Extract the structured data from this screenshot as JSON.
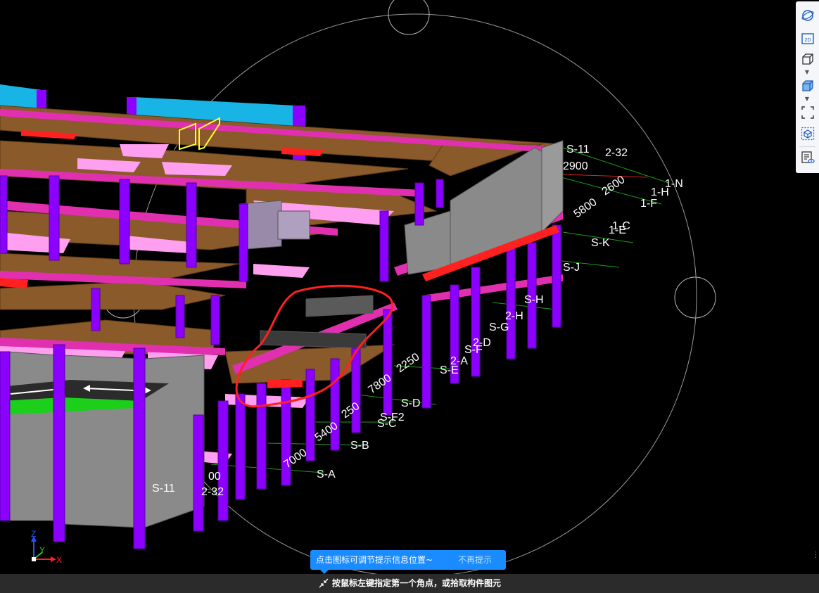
{
  "tip": {
    "text": "点击图标可调节提示信息位置~",
    "dismiss": "不再提示"
  },
  "status": {
    "text": "按鼠标左键指定第一个角点，或拾取构件图元"
  },
  "toolbar": {
    "items": [
      {
        "icon": "orbit-icon"
      },
      {
        "icon": "2d-view-icon",
        "text": "2D"
      },
      {
        "icon": "3d-box-icon"
      },
      {
        "icon": "dropdown-caret-icon"
      },
      {
        "icon": "3d-solid-box-icon"
      },
      {
        "icon": "dropdown-caret-icon"
      },
      {
        "icon": "zoom-extents-icon"
      },
      {
        "icon": "component-selection-icon"
      },
      {
        "icon": "properties-view-icon"
      }
    ]
  },
  "axis_triad": {
    "z": "Z",
    "y": "Y",
    "x": "X"
  },
  "grid_labels": [
    "S-11",
    "2-32",
    "2900",
    "1-H",
    "1-N",
    "1-F",
    "1-C",
    "1-E",
    "S-K",
    "S-J",
    "2-H",
    "S-H",
    "S-G",
    "2-D",
    "S-F",
    "2-A",
    "S-E",
    "2250",
    "7800",
    "S-D",
    "250",
    "5400",
    "S-C",
    "S-B",
    "7000",
    "S-A",
    "00",
    "S-11",
    "2-32",
    "S-F2",
    "5800",
    "2600"
  ],
  "colors": {
    "background": "#000000",
    "column": "#8b00ff",
    "beam": "#e030b0",
    "slab": "#8b5a2b",
    "wall": "#808080",
    "cyan_beam": "#19b4e6",
    "highlight_red": "#ff2020",
    "selection_yellow": "#ffff33",
    "tip_bg": "#1a8cff",
    "status_bg": "#2b2b2b"
  }
}
